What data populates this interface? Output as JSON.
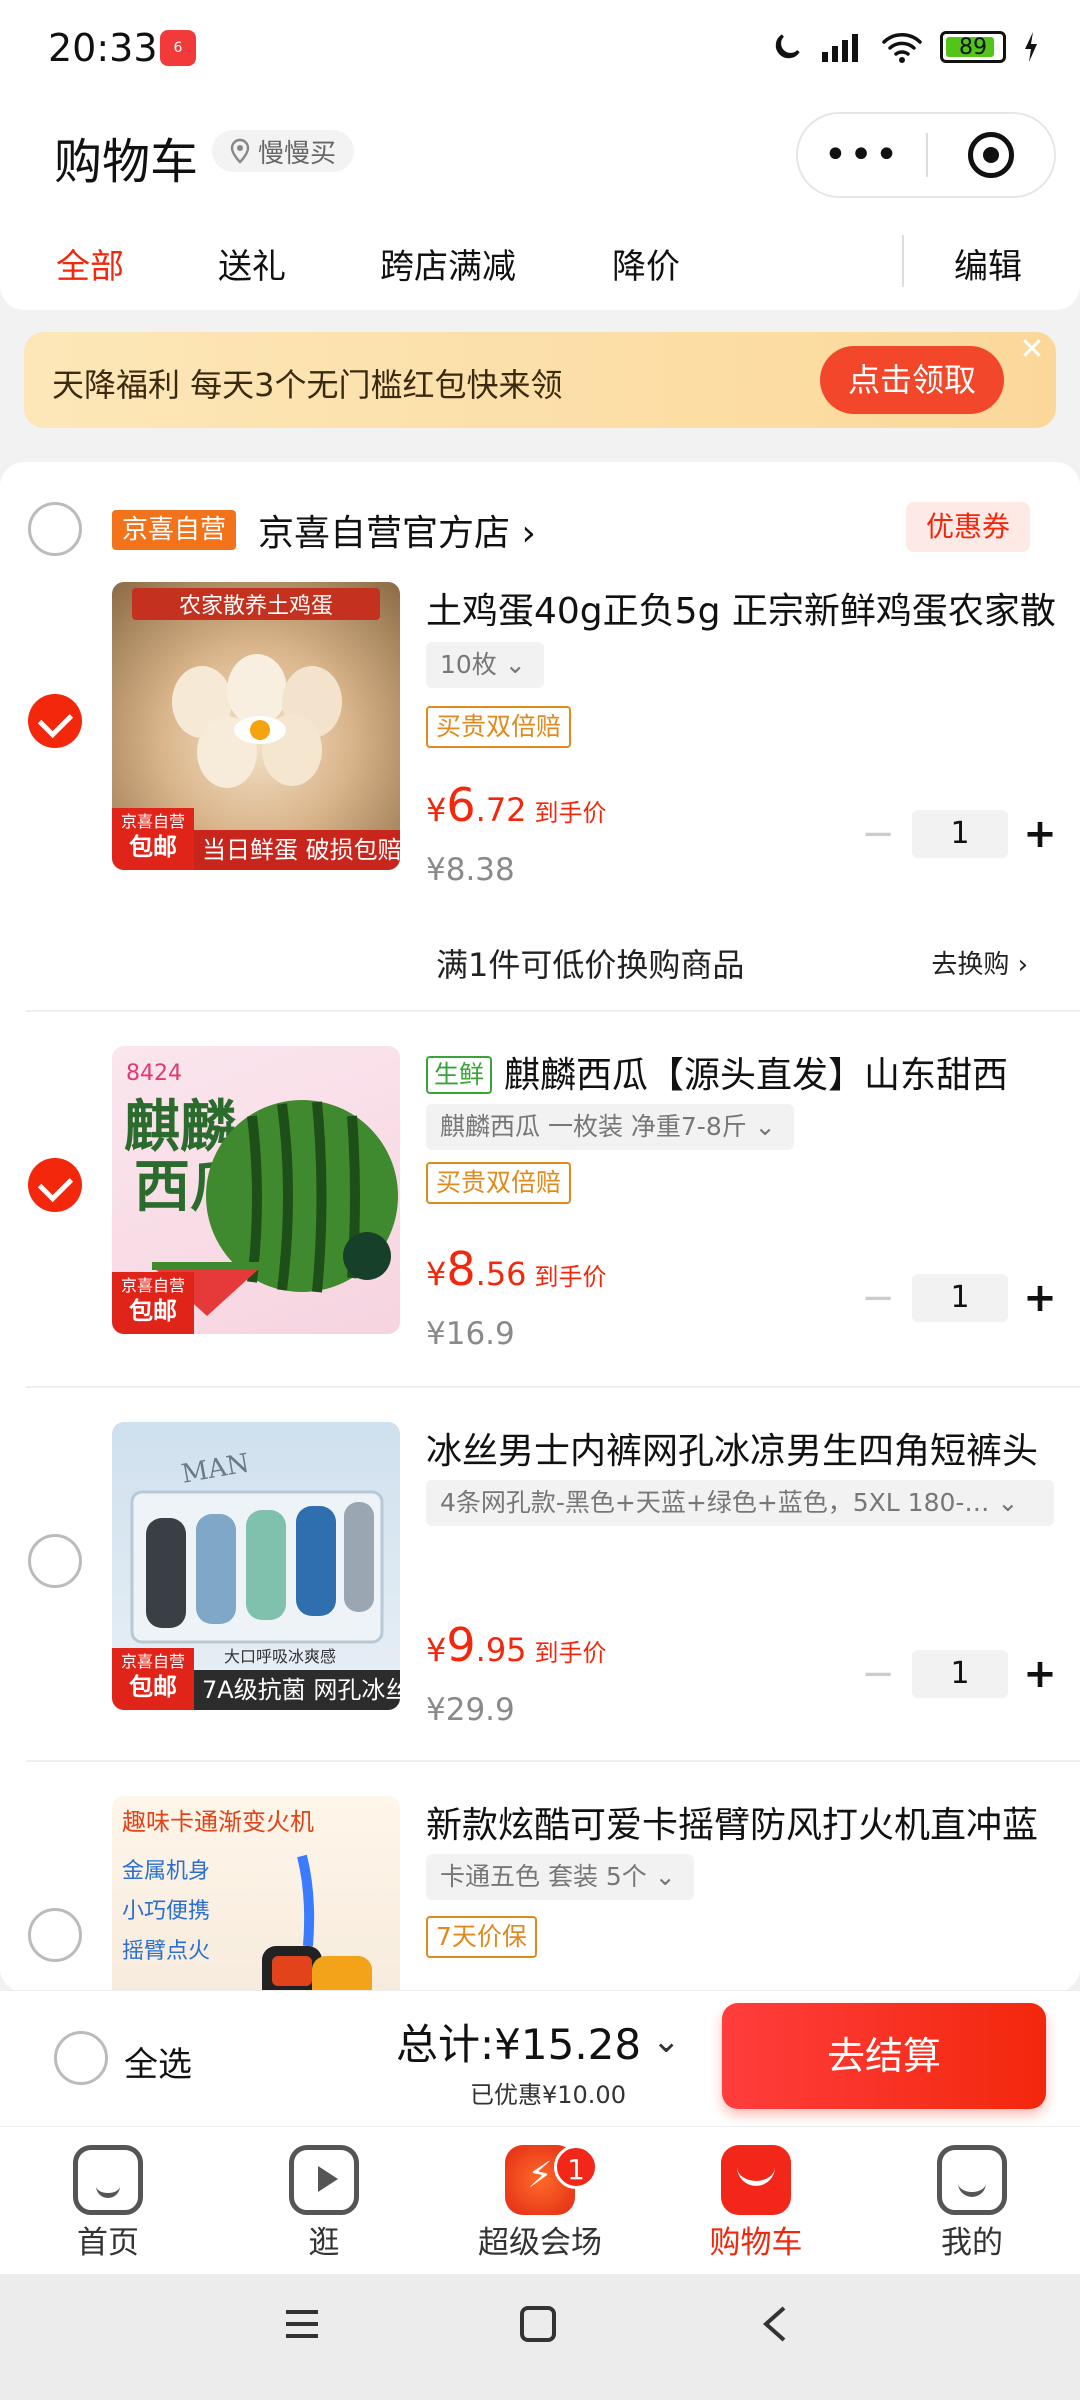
{
  "status_bar": {
    "time": "20:33",
    "battery": "89",
    "battery_level": 0.89
  },
  "header": {
    "title": "购物车",
    "location": "慢慢买",
    "more_label": "•••"
  },
  "tabs": [
    {
      "label": "全部",
      "active": true
    },
    {
      "label": "送礼"
    },
    {
      "label": "跨店满减"
    },
    {
      "label": "降价"
    }
  ],
  "edit_label": "编辑",
  "promo": {
    "text": "天降福利 每天3个无门槛红包快来领",
    "button": "点击领取",
    "close": "✕"
  },
  "store": {
    "badge": "京喜自营",
    "name": "京喜自营官方店 ›",
    "coupon": "优惠券"
  },
  "items": [
    {
      "name": "土鸡蛋40g正负5g 正宗新鲜鸡蛋农家散",
      "spec": "10枚  ⌄",
      "badge": "买贵双倍赔",
      "price_currency": "¥",
      "price_int": "6",
      "price_dec": ".72",
      "price_label": "到手价",
      "original_price": "¥8.38",
      "qty": "1",
      "checked": true,
      "thumb_caption": "农家散养土鸡蛋",
      "thumb_tag_top": "京喜自营",
      "thumb_tag_main": "包邮",
      "thumb_strip": "当日鲜蛋 破损包赔"
    },
    {
      "fresh_tag": "生鲜",
      "name": "麒麟西瓜【源头直发】山东甜西",
      "spec": "麒麟西瓜 一枚装 净重7-8斤  ⌄",
      "badge": "买贵双倍赔",
      "price_currency": "¥",
      "price_int": "8",
      "price_dec": ".56",
      "price_label": "到手价",
      "original_price": "¥16.9",
      "qty": "1",
      "checked": true,
      "thumb_tag_top": "京喜自营",
      "thumb_tag_main": "包邮"
    },
    {
      "name": "冰丝男士内裤网孔冰凉男生四角短裤头",
      "spec": "4条网孔款-黑色+天蓝+绿色+蓝色，5XL 180-…  ⌄",
      "price_currency": "¥",
      "price_int": "9",
      "price_dec": ".95",
      "price_label": "到手价",
      "original_price": "¥29.9",
      "qty": "1",
      "checked": false,
      "thumb_tag_top": "京喜自营",
      "thumb_tag_main": "包邮",
      "thumb_strip": "7A级抗菌  网孔冰丝"
    },
    {
      "name": "新款炫酷可爱卡摇臂防风打火机直冲蓝",
      "spec": "卡通五色 套装 5个  ⌄",
      "badge": "7天价保",
      "checked": false,
      "thumb_caption": "趣味卡通渐变火机"
    }
  ],
  "exchange": {
    "text": "满1件可低价换购商品",
    "link": "去换购 ›"
  },
  "checkout": {
    "select_all": "全选",
    "total": "总计:¥15.28",
    "saved": "已优惠¥10.00",
    "button": "去结算"
  },
  "tabbar": [
    {
      "label": "首页"
    },
    {
      "label": "逛"
    },
    {
      "label": "超级会场",
      "badge": "1"
    },
    {
      "label": "购物车",
      "active": true
    },
    {
      "label": "我的"
    }
  ],
  "colors": {
    "accent": "#f2270c",
    "promo_bg": "#fbd89a",
    "fresh": "#3aa43a",
    "badge_orange": "#e08a1e"
  }
}
